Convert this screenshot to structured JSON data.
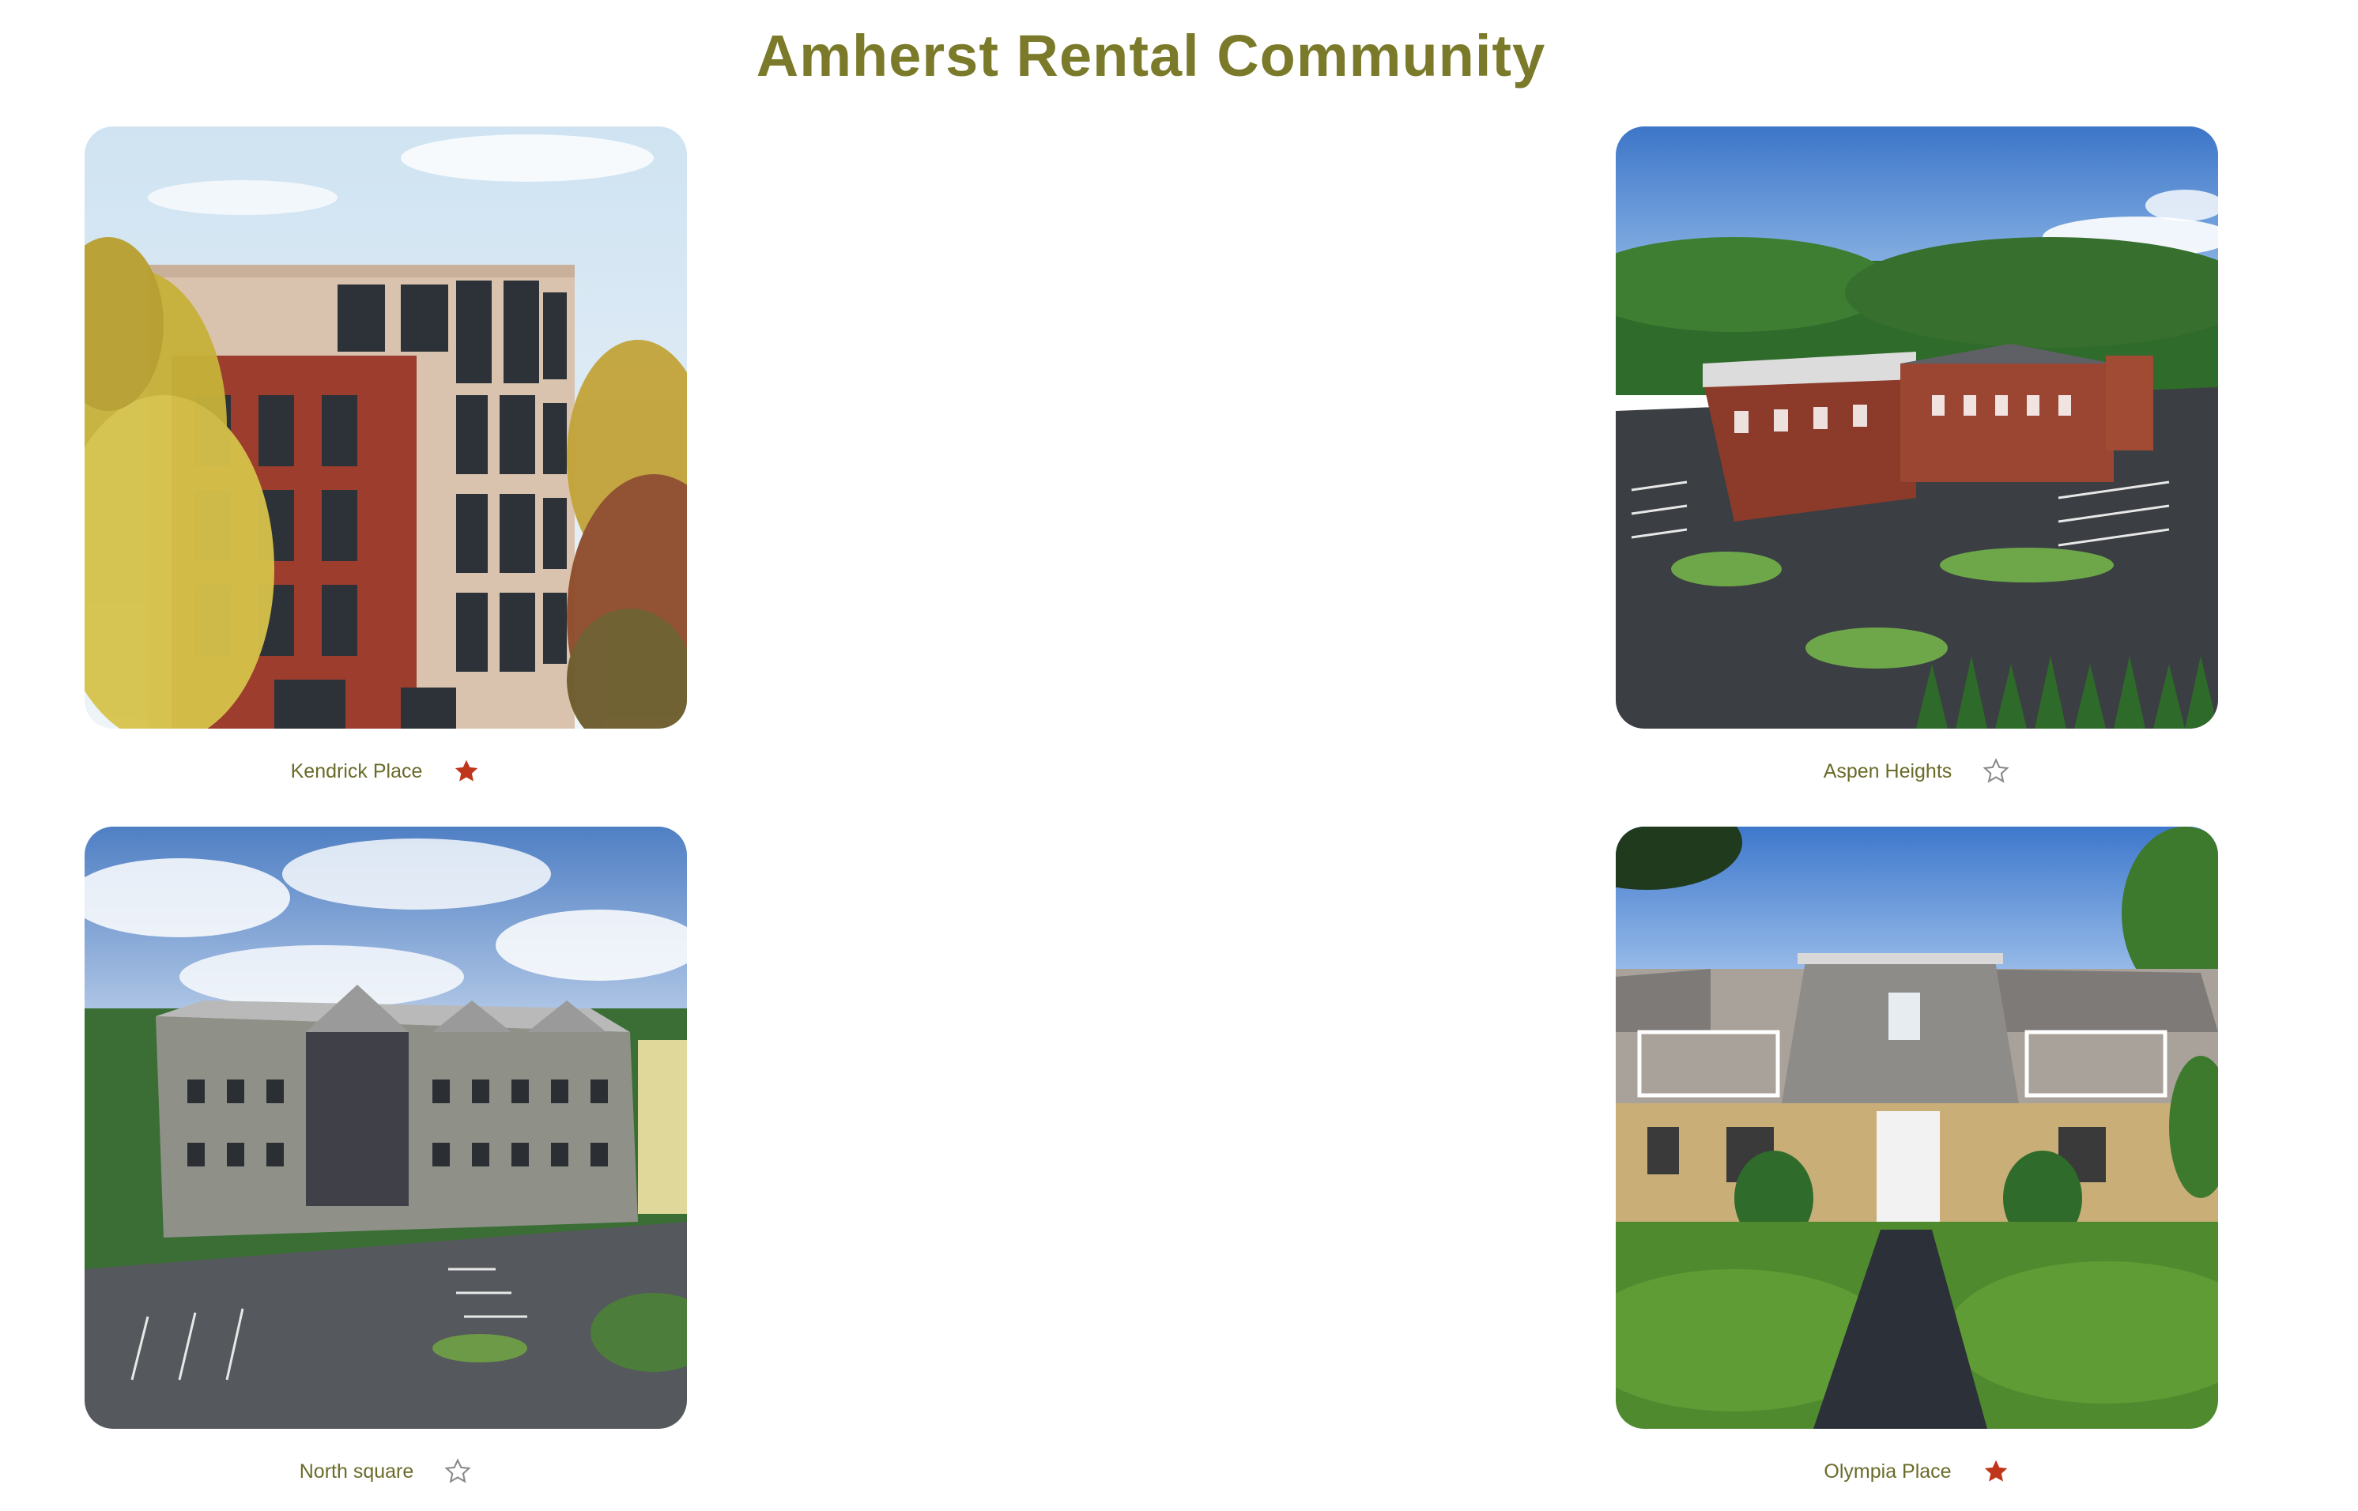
{
  "page": {
    "title": "Amherst Rental Community",
    "title_color": "#7a7a2a",
    "caption_color": "#6b6b2a",
    "star_filled_color": "#c0361c",
    "star_empty_color": "#8a8a8a"
  },
  "properties": [
    {
      "name": "Kendrick Place",
      "favorite": true,
      "icon": "star-filled-icon"
    },
    {
      "name": "Aspen Heights",
      "favorite": false,
      "icon": "star-outline-icon"
    },
    {
      "name": "North square",
      "favorite": false,
      "icon": "star-outline-icon"
    },
    {
      "name": "Olympia Place",
      "favorite": true,
      "icon": "star-filled-icon"
    }
  ]
}
